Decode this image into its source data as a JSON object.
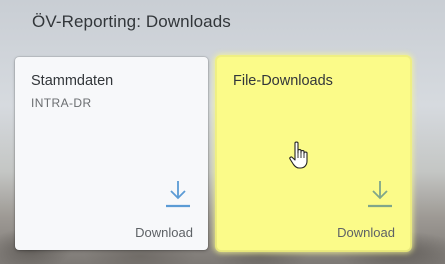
{
  "group": {
    "title": "ÖV-Reporting: Downloads"
  },
  "tiles": [
    {
      "title": "Stammdaten",
      "subtitle": "INTRA-DR",
      "footer": "Download",
      "icon": "download-icon",
      "color": "#f7f8fa"
    },
    {
      "title": "File-Downloads",
      "subtitle": "",
      "footer": "Download",
      "icon": "download-icon",
      "color": "#fbfb89",
      "hovered": true
    }
  ],
  "cursor": {
    "icon": "hand-pointer-icon"
  },
  "colors": {
    "icon_blue": "#5b9bd5",
    "icon_line": "#7fa68a"
  }
}
